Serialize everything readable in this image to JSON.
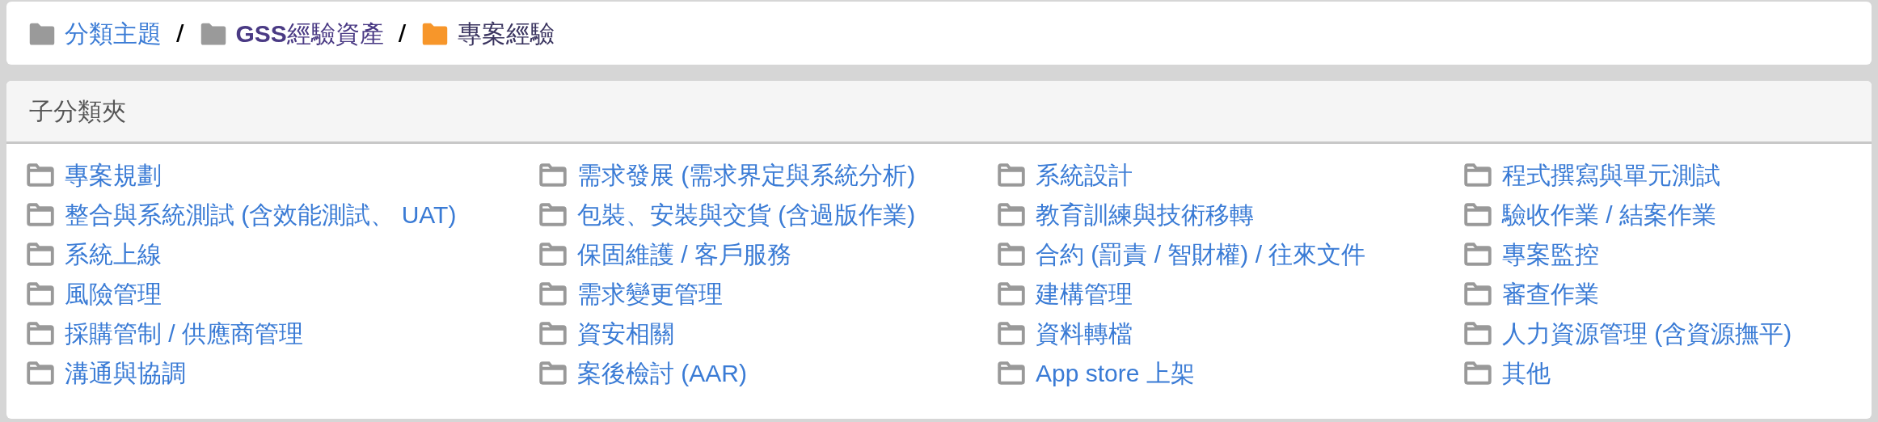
{
  "breadcrumb": [
    {
      "label": "分類主題",
      "visited": false,
      "current": false
    },
    {
      "label": "**GSS**經驗資產",
      "visited": true,
      "current": false
    },
    {
      "label": "專案經驗",
      "current": true
    }
  ],
  "breadcrumb_separator": "/",
  "panel": {
    "title": "子分類夾",
    "items": [
      "專案規劃",
      "需求發展 (需求界定與系統分析)",
      "系統設計",
      "程式撰寫與單元測試",
      "整合與系統測試 (含效能測試、 UAT)",
      "包裝、安裝與交貨 (含過版作業)",
      "教育訓練與技術移轉",
      "驗收作業 / 結案作業",
      "系統上線",
      "保固維護 / 客戶服務",
      "合約 (罰責 / 智財權) / 往來文件",
      "專案監控",
      "風險管理",
      "需求變更管理",
      "建構管理",
      "審查作業",
      "採購管制 / 供應商管理",
      "資安相關",
      "資料轉檔",
      "人力資源管理 (含資源撫平)",
      "溝通與協調",
      "案後檢討 (AAR)",
      "App store 上架",
      "其他"
    ]
  }
}
